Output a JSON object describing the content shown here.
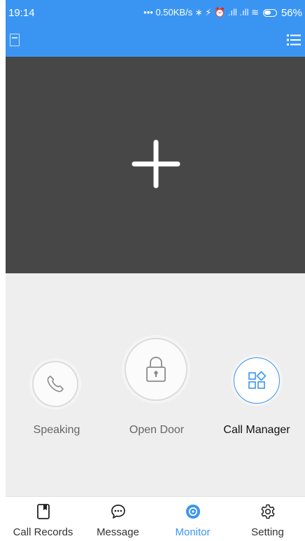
{
  "status_bar": {
    "time": "19:14",
    "indicators": "••• 0.50KB/s ∗ ⚡ ⏰ .ıll .ıll ≋",
    "battery": "56%"
  },
  "header": {
    "left_icon": "document-icon",
    "right_icon": "list-menu-icon"
  },
  "video": {
    "add_icon": "plus-icon"
  },
  "controls": {
    "speaking_label": "Speaking",
    "open_door_label": "Open Door",
    "call_manager_label": "Call Manager"
  },
  "nav": {
    "items": [
      {
        "label": "Call Records",
        "icon": "bookmark-icon"
      },
      {
        "label": "Message",
        "icon": "chat-bubble-icon"
      },
      {
        "label": "Monitor",
        "icon": "monitor-target-icon",
        "active": true
      },
      {
        "label": "Setting",
        "icon": "gear-icon"
      }
    ]
  },
  "colors": {
    "accent": "#3a95f2",
    "video_bg": "#474747",
    "controls_bg": "#eeeeee"
  }
}
